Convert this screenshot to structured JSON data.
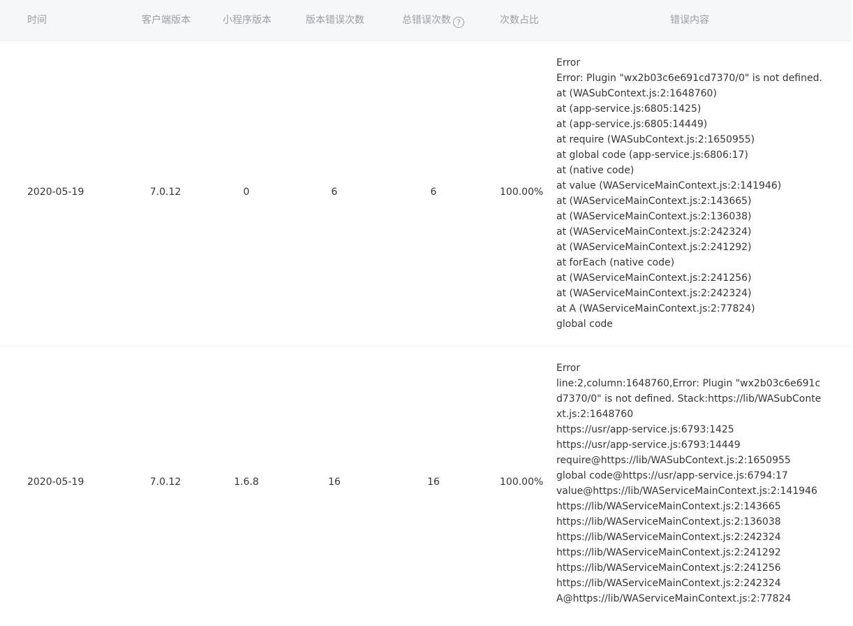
{
  "table": {
    "headers": {
      "time": "时间",
      "client_version": "客户端版本",
      "mini_version": "小程序版本",
      "version_errors": "版本错误次数",
      "total_errors": "总错误次数",
      "total_errors_help": "?",
      "ratio": "次数占比",
      "content": "错误内容"
    },
    "rows": [
      {
        "time": "2020-05-19",
        "client_version": "7.0.12",
        "mini_version": "0",
        "version_errors": "6",
        "total_errors": "6",
        "ratio": "100.00%",
        "content": [
          "Error",
          "Error: Plugin \"wx2b03c6e691cd7370/0\" is not defined.",
          "at (WASubContext.js:2:1648760)",
          "at (app-service.js:6805:1425)",
          "at (app-service.js:6805:14449)",
          "at require (WASubContext.js:2:1650955)",
          "at global code (app-service.js:6806:17)",
          "at (native code)",
          "at value (WAServiceMainContext.js:2:141946)",
          "at (WAServiceMainContext.js:2:143665)",
          "at (WAServiceMainContext.js:2:136038)",
          "at (WAServiceMainContext.js:2:242324)",
          "at (WAServiceMainContext.js:2:241292)",
          "at forEach (native code)",
          "at (WAServiceMainContext.js:2:241256)",
          "at (WAServiceMainContext.js:2:242324)",
          "at A (WAServiceMainContext.js:2:77824)",
          "global code"
        ]
      },
      {
        "time": "2020-05-19",
        "client_version": "7.0.12",
        "mini_version": "1.6.8",
        "version_errors": "16",
        "total_errors": "16",
        "ratio": "100.00%",
        "content": [
          "Error",
          "line:2,column:1648760,Error: Plugin \"wx2b03c6e691cd7370/0\" is not defined. Stack:https://lib/WASubContext.js:2:1648760",
          "https://usr/app-service.js:6793:1425",
          "https://usr/app-service.js:6793:14449",
          "require@https://lib/WASubContext.js:2:1650955",
          "global code@https://usr/app-service.js:6794:17",
          "value@https://lib/WAServiceMainContext.js:2:141946",
          "https://lib/WAServiceMainContext.js:2:143665",
          "https://lib/WAServiceMainContext.js:2:136038",
          "https://lib/WAServiceMainContext.js:2:242324",
          "https://lib/WAServiceMainContext.js:2:241292",
          "https://lib/WAServiceMainContext.js:2:241256",
          "https://lib/WAServiceMainContext.js:2:242324",
          "A@https://lib/WAServiceMainContext.js:2:77824"
        ]
      }
    ]
  }
}
